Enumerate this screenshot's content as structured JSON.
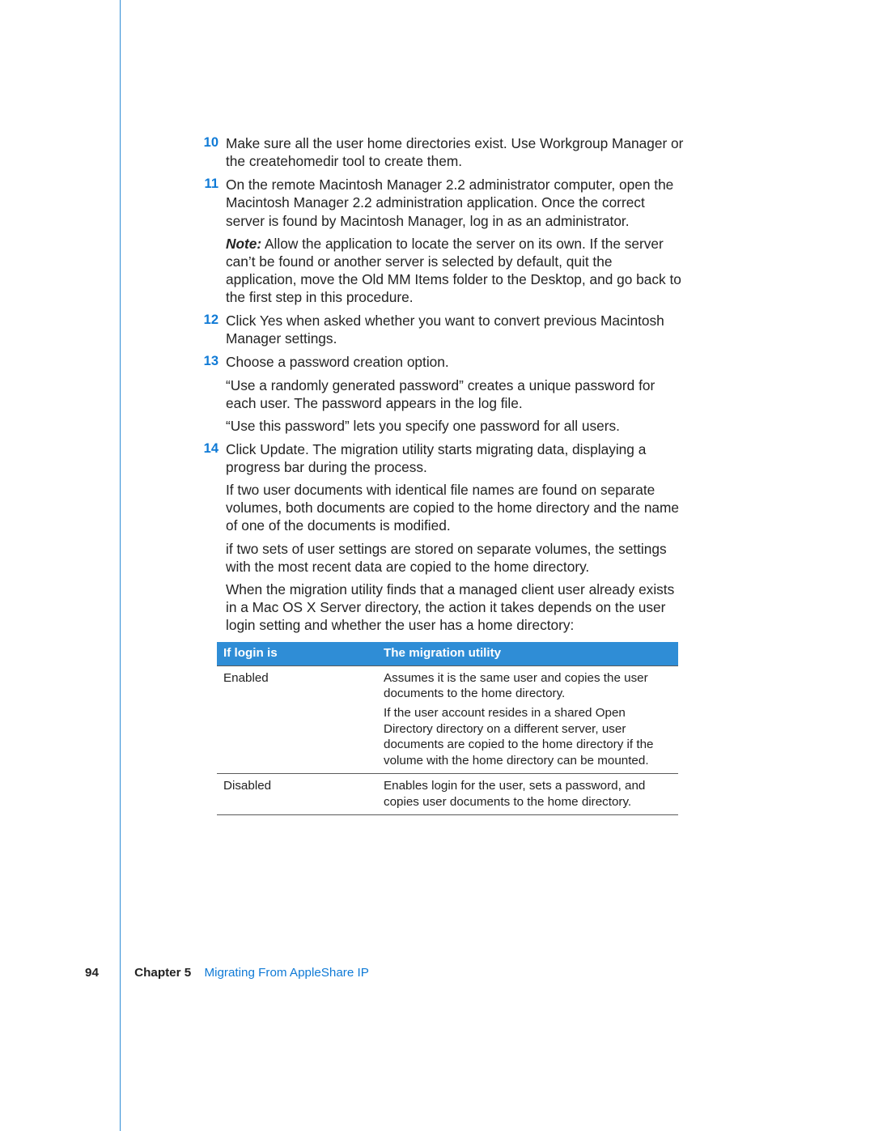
{
  "steps": [
    {
      "num": "10",
      "paras": [
        "Make sure all the user home directories exist. Use Workgroup Manager or the createhomedir tool to create them."
      ]
    },
    {
      "num": "11",
      "paras": [
        "On the remote Macintosh Manager 2.2 administrator computer, open the Macintosh Manager 2.2 administration application. Once the correct server is found by Macintosh Manager, log in as an administrator.",
        {
          "noteLabel": "Note:",
          "text": "  Allow the application to locate the server on its own. If the server can’t be found or another server is selected by default, quit the application, move the Old MM Items folder to the Desktop, and go back to the first step in this procedure."
        }
      ]
    },
    {
      "num": "12",
      "paras": [
        "Click Yes when asked whether you want to convert previous Macintosh Manager settings."
      ]
    },
    {
      "num": "13",
      "paras": [
        "Choose a password creation option.",
        "“Use a randomly generated password” creates a unique password for each user. The password appears in the log file.",
        "“Use this password” lets you specify one password for all users."
      ]
    },
    {
      "num": "14",
      "paras": [
        "Click Update. The migration utility starts migrating data, displaying a progress bar during the process.",
        "If two user documents with identical file names are found on separate volumes, both documents are copied to the home directory and the name of one of the documents is modified.",
        "if two sets of user settings are stored on separate volumes, the settings with the most recent data are copied to the home directory.",
        "When the migration utility finds that a managed client user already exists in a Mac OS X Server directory, the action it takes depends on the user login setting and whether the user has a home directory:"
      ]
    }
  ],
  "table": {
    "headers": [
      "If login is",
      "The migration utility"
    ],
    "rows": [
      {
        "c1": "Enabled",
        "c2": [
          "Assumes it is the same user and copies the user documents to the home directory.",
          "If the user account resides in a shared Open Directory directory on a different server, user documents are copied to the home directory if the volume with the home directory can be mounted."
        ]
      },
      {
        "c1": "Disabled",
        "c2": [
          "Enables login for the user, sets a password, and copies user documents to the home directory."
        ]
      }
    ]
  },
  "footer": {
    "pageNumber": "94",
    "chapterLabel": "Chapter 5",
    "chapterTitle": "Migrating From AppleShare IP"
  }
}
